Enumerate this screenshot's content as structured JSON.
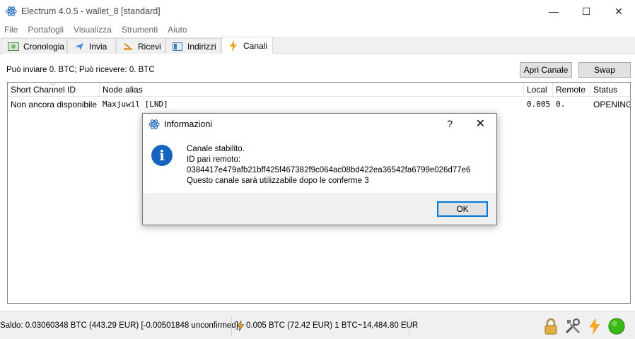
{
  "window": {
    "title": "Electrum 4.0.5  -  wallet_8  [standard]",
    "minimize": "—",
    "maximize": "☐",
    "close": "✕"
  },
  "menu": [
    "File",
    "Portafogli",
    "Visualizza",
    "Strumenti",
    "Aiuto"
  ],
  "tabs": [
    {
      "label": "Cronologia",
      "icon": "history-icon"
    },
    {
      "label": "Invia",
      "icon": "send-icon"
    },
    {
      "label": "Ricevi",
      "icon": "receive-icon"
    },
    {
      "label": "Indirizzi",
      "icon": "addresses-icon"
    },
    {
      "label": "Canali",
      "icon": "lightning-icon",
      "active": true
    }
  ],
  "channels": {
    "summary": "Può inviare 0. BTC; Può ricevere: 0. BTC",
    "open_channel_label": "Apri Canale",
    "swap_label": "Swap",
    "columns": [
      "Short Channel ID",
      "Node alias",
      "Local",
      "Remote",
      "Status"
    ],
    "rows": [
      {
        "short_channel_id": "Non ancora disponibile",
        "node_alias": "Maxjuwil [LND]",
        "local": "0.005",
        "remote": "0.",
        "status": "OPENING"
      }
    ]
  },
  "dialog": {
    "title": "Informazioni",
    "help": "?",
    "close": "✕",
    "info_glyph": "i",
    "message_lines": [
      "Canale stabilito.",
      "ID pari remoto:",
      "0384417e479afb21bff425f467382f9c064ac08bd422ea36542fa6799e026d77e6",
      "Questo canale sarà utilizzabile dopo le conferme 3"
    ],
    "ok_label": "OK"
  },
  "status": {
    "balance": "Saldo: 0.03060348 BTC (443.29 EUR)  [-0.00501848 unconfirmed]",
    "lightning": "0.005 BTC (72.42 EUR) 1 BTC~14,484.80 EUR",
    "icons": [
      "lock-icon",
      "tools-icon",
      "lightning-icon",
      "network-status-icon"
    ]
  },
  "colors": {
    "accent": "#0078d7",
    "info_blue": "#1565c0",
    "lightning": "#f5a623",
    "status_green": "#3cb916"
  }
}
